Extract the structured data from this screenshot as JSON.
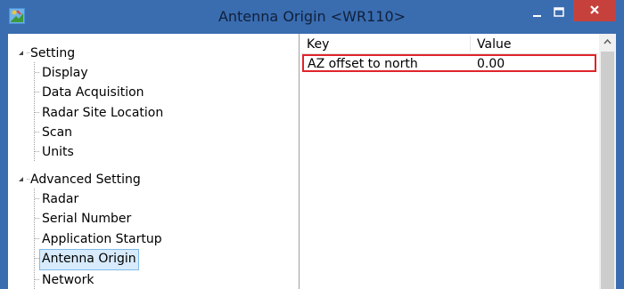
{
  "window": {
    "title": "Antenna Origin <WR110>",
    "minimize_icon": "minimize-icon",
    "maximize_icon": "maximize-icon",
    "close_icon": "close-icon"
  },
  "tree": {
    "groups": [
      {
        "label": "Setting",
        "expanded": true,
        "items": [
          "Display",
          "Data Acquisition",
          "Radar Site Location",
          "Scan",
          "Units"
        ]
      },
      {
        "label": "Advanced Setting",
        "expanded": true,
        "items": [
          "Radar",
          "Serial Number",
          "Application Startup",
          "Antenna Origin",
          "Network"
        ]
      }
    ],
    "selected": "Antenna Origin"
  },
  "grid": {
    "columns": [
      "Key",
      "Value"
    ],
    "rows": [
      {
        "key": "AZ offset to north",
        "value": "0.00"
      }
    ]
  },
  "colors": {
    "titlebar": "#3a6cb0",
    "close_button": "#c7413c",
    "selection_bg": "#d7ebfc",
    "selection_border": "#7fbaea",
    "row_highlight": "#e0242a"
  }
}
